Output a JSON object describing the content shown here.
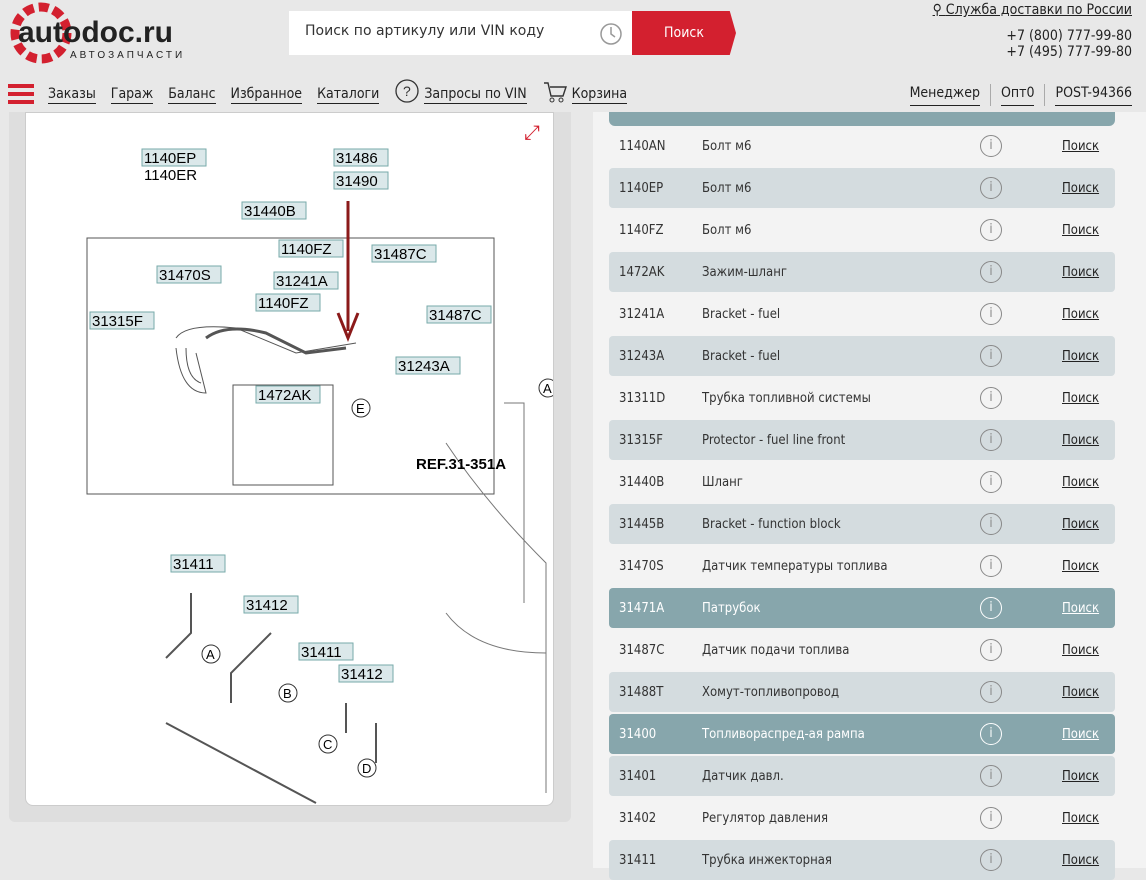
{
  "header": {
    "logo_text": "autodoc.ru",
    "logo_sub": "АВТОЗАПЧАСТИ",
    "search_placeholder": "Поиск по артикулу или VIN коду",
    "search_button": "Поиск",
    "delivery": "Служба доставки по России",
    "phones": [
      "+7 (800) 777-99-80",
      "+7 (495) 777-99-80"
    ]
  },
  "nav": {
    "items": [
      "Заказы",
      "Гараж",
      "Баланс",
      "Избранное",
      "Каталоги",
      "Запросы по VIN",
      "Корзина"
    ],
    "right": [
      "Менеджер",
      "Опт0",
      "POST-94366"
    ]
  },
  "colors": {
    "brand": "#d3202f",
    "selected_row": "#87a6ac",
    "alt_row": "#d4dcdf"
  },
  "diagram": {
    "labels": [
      "1140EP",
      "1140ER",
      "31486",
      "31490",
      "31440B",
      "1140FZ",
      "31487C",
      "31470S",
      "31241A",
      "1140FZ",
      "31315F",
      "31487C",
      "31243A",
      "1472AK",
      "E",
      "A",
      "REF.31-351A",
      "31411",
      "31412",
      "31411",
      "31412",
      "A",
      "B",
      "C",
      "D"
    ]
  },
  "parts": {
    "search_label": "Поиск",
    "rows": [
      {
        "code": "1140AN",
        "name": "Болт м6",
        "state": "normal"
      },
      {
        "code": "1140EP",
        "name": "Болт м6",
        "state": "alt"
      },
      {
        "code": "1140FZ",
        "name": "Болт м6",
        "state": "normal"
      },
      {
        "code": "1472AK",
        "name": "Зажим-шланг",
        "state": "alt"
      },
      {
        "code": "31241A",
        "name": "Bracket - fuel",
        "state": "normal"
      },
      {
        "code": "31243A",
        "name": "Bracket - fuel",
        "state": "alt"
      },
      {
        "code": "31311D",
        "name": "Трубка топливной системы",
        "state": "normal"
      },
      {
        "code": "31315F",
        "name": "Protector - fuel line front",
        "state": "alt"
      },
      {
        "code": "31440B",
        "name": "Шланг",
        "state": "normal"
      },
      {
        "code": "31445B",
        "name": "Bracket - function block",
        "state": "alt"
      },
      {
        "code": "31470S",
        "name": "Датчик температуры топлива",
        "state": "normal"
      },
      {
        "code": "31471A",
        "name": "Патрубок",
        "state": "selected"
      },
      {
        "code": "31487C",
        "name": "Датчик подачи топлива",
        "state": "normal"
      },
      {
        "code": "31488T",
        "name": "Хомут-топливопровод",
        "state": "alt"
      },
      {
        "code": "31400",
        "name": "Топливораспред-ая рампа",
        "state": "selected"
      },
      {
        "code": "31401",
        "name": "Датчик давл.",
        "state": "alt"
      },
      {
        "code": "31402",
        "name": "Регулятор давления",
        "state": "normal"
      },
      {
        "code": "31411",
        "name": "Трубка инжекторная",
        "state": "alt"
      }
    ]
  }
}
